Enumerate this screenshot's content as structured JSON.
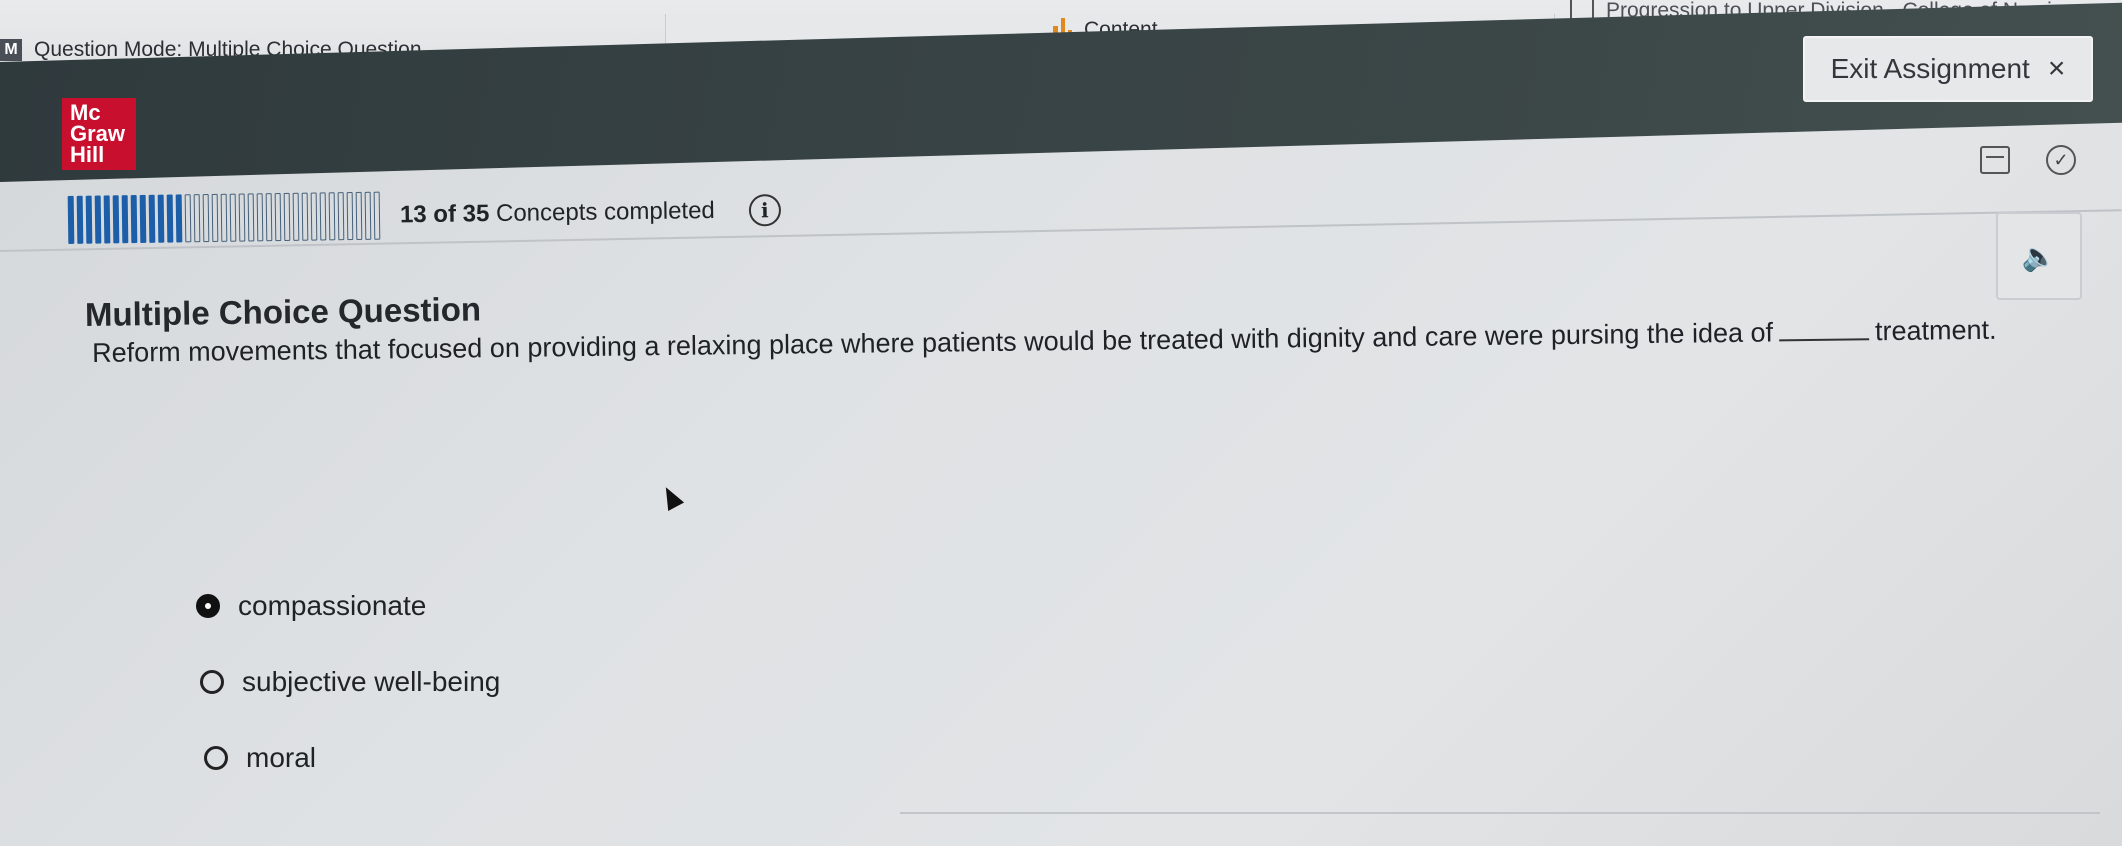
{
  "browser": {
    "tabs": [
      {
        "label": "Question Mode: Multiple Choice Question",
        "favicon": "M"
      },
      {
        "label": "Content"
      },
      {
        "label": "Progression to Upper Division - College of Nursing"
      }
    ]
  },
  "header": {
    "logo_lines": [
      "Mc",
      "Graw",
      "Hill"
    ],
    "exit_label": "Exit Assignment",
    "exit_icon": "×",
    "brand_color": "#c8102e"
  },
  "progress": {
    "completed": "13",
    "of_label": "of",
    "total": "35",
    "suffix": "Concepts completed",
    "fraction": 0.371,
    "info_glyph": "i",
    "fill_color": "#1c5fa8"
  },
  "question": {
    "heading": "Multiple Choice Question",
    "text_before_blank": "Reform movements that focused on providing a relaxing place where patients would be treated with dignity and care were pursing the idea of",
    "text_after_blank": "treatment.",
    "options": [
      {
        "label": "compassionate",
        "selected": true
      },
      {
        "label": "subjective well-being",
        "selected": false
      },
      {
        "label": "moral",
        "selected": false
      }
    ]
  },
  "icons": {
    "audio": "speaker-icon",
    "calendar": "calendar-icon",
    "check": "check-circle-icon"
  }
}
